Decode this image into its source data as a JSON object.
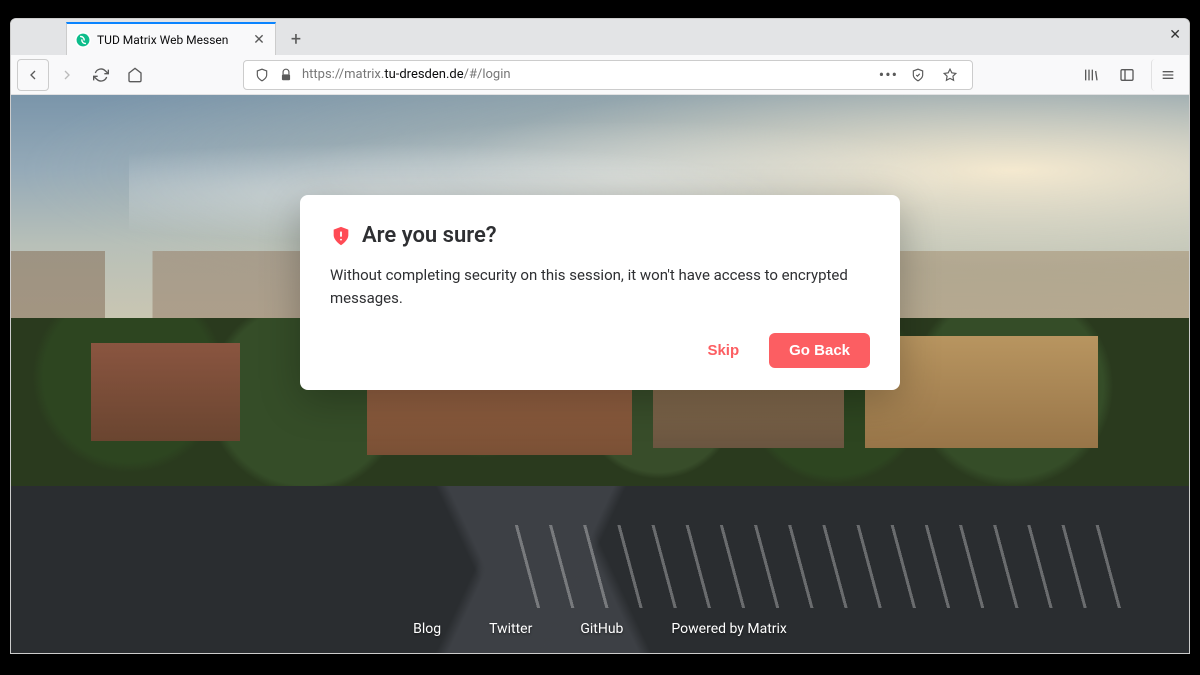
{
  "browser": {
    "tab": {
      "title": "TUD Matrix Web Messen",
      "favicon_color": "#0dbd8b"
    },
    "url": {
      "protocol": "https://",
      "sub": "matrix.",
      "domain": "tu-dresden.de",
      "path": "/#/login"
    }
  },
  "dialog": {
    "title": "Are you sure?",
    "body": "Without completing security on this session, it won't have access to encrypted messages.",
    "skip_label": "Skip",
    "primary_label": "Go Back"
  },
  "footer": {
    "links": [
      "Blog",
      "Twitter",
      "GitHub",
      "Powered by Matrix"
    ]
  }
}
